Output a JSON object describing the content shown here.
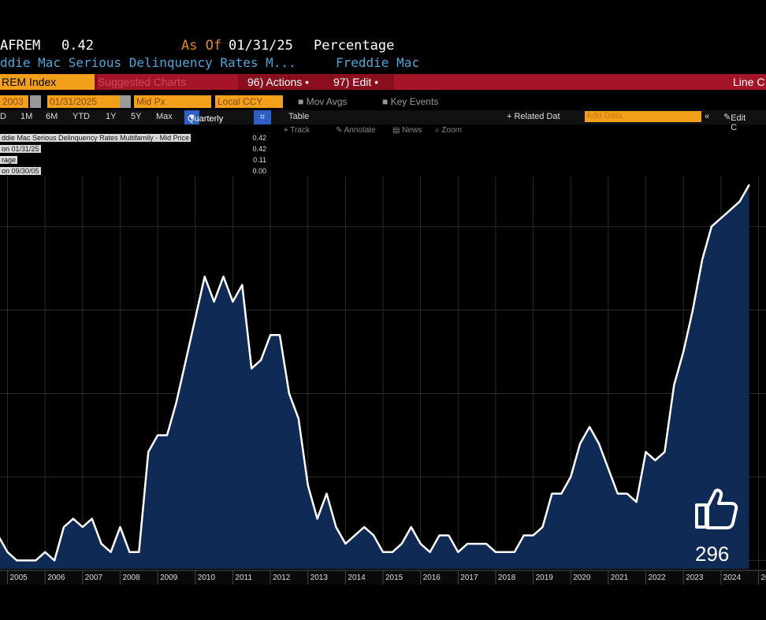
{
  "header": {
    "ticker": "AFREM",
    "last_value": "0.42",
    "as_of_label": "As Of",
    "as_of_date": "01/31/25",
    "unit": "Percentage",
    "description": "ddie Mac Serious Delinquency Rates M...",
    "source": "Freddie Mac"
  },
  "toolbar": {
    "index": "REM Index",
    "suggested": "Suggested Charts",
    "actions": "96) Actions •",
    "edit": "97) Edit •",
    "chart_type": "Line C"
  },
  "controls": {
    "start_date": "2003",
    "end_date": "01/31/2025",
    "price_field": "Mid Px",
    "currency": "Local CCY",
    "mov_avgs": "Mov Avgs",
    "key_events": "Key Events"
  },
  "periods": [
    "D",
    "1M",
    "6M",
    "YTD",
    "1Y",
    "5Y",
    "Max"
  ],
  "frequency": "Quarterly",
  "table_label": "Table",
  "related_data": "+ Related Dat",
  "add_data": "Add Data",
  "edit_chart": "Edit C",
  "tools": [
    "Track",
    "Annotate",
    "News",
    "Zoom"
  ],
  "legend": [
    {
      "label": "ddie Mac Serious Delinquency Rates Multifamily - Mid Price",
      "value": "0.42"
    },
    {
      "label": "on 01/31/25",
      "value": "0.42"
    },
    {
      "label": "rage",
      "value": "0.11"
    },
    {
      "label": "on 09/30/05",
      "value": "0.00"
    }
  ],
  "like_count": "296",
  "chart_data": {
    "type": "area",
    "title": "",
    "xlabel": "",
    "ylabel": "",
    "xlim": [
      2004.8,
      2025.2
    ],
    "ylim": [
      -0.01,
      0.46
    ],
    "x_ticks": [
      "2005",
      "2006",
      "2007",
      "2008",
      "2009",
      "2010",
      "2011",
      "2012",
      "2013",
      "2014",
      "2015",
      "2016",
      "2017",
      "2018",
      "2019",
      "2020",
      "2021",
      "2022",
      "2023",
      "2024",
      "20"
    ],
    "grid": true,
    "line_color": "#ffffff",
    "fill_color": "#0f2a55",
    "series": [
      {
        "points": [
          [
            2004.75,
            0.03
          ],
          [
            2005.0,
            0.01
          ],
          [
            2005.25,
            0.0
          ],
          [
            2005.5,
            0.0
          ],
          [
            2005.75,
            0.0
          ],
          [
            2006.0,
            0.01
          ],
          [
            2006.25,
            0.0
          ],
          [
            2006.5,
            0.04
          ],
          [
            2006.75,
            0.05
          ],
          [
            2007.0,
            0.04
          ],
          [
            2007.25,
            0.05
          ],
          [
            2007.5,
            0.02
          ],
          [
            2007.75,
            0.01
          ],
          [
            2008.0,
            0.04
          ],
          [
            2008.25,
            0.01
          ],
          [
            2008.5,
            0.01
          ],
          [
            2008.75,
            0.13
          ],
          [
            2009.0,
            0.15
          ],
          [
            2009.25,
            0.15
          ],
          [
            2009.5,
            0.19
          ],
          [
            2009.75,
            0.24
          ],
          [
            2010.0,
            0.29
          ],
          [
            2010.25,
            0.34
          ],
          [
            2010.5,
            0.31
          ],
          [
            2010.75,
            0.34
          ],
          [
            2011.0,
            0.31
          ],
          [
            2011.25,
            0.33
          ],
          [
            2011.5,
            0.23
          ],
          [
            2011.75,
            0.24
          ],
          [
            2012.0,
            0.27
          ],
          [
            2012.25,
            0.27
          ],
          [
            2012.5,
            0.2
          ],
          [
            2012.75,
            0.17
          ],
          [
            2013.0,
            0.09
          ],
          [
            2013.25,
            0.05
          ],
          [
            2013.5,
            0.08
          ],
          [
            2013.75,
            0.04
          ],
          [
            2014.0,
            0.02
          ],
          [
            2014.25,
            0.03
          ],
          [
            2014.5,
            0.04
          ],
          [
            2014.75,
            0.03
          ],
          [
            2015.0,
            0.01
          ],
          [
            2015.25,
            0.01
          ],
          [
            2015.5,
            0.02
          ],
          [
            2015.75,
            0.04
          ],
          [
            2016.0,
            0.02
          ],
          [
            2016.25,
            0.01
          ],
          [
            2016.5,
            0.03
          ],
          [
            2016.75,
            0.03
          ],
          [
            2017.0,
            0.01
          ],
          [
            2017.25,
            0.02
          ],
          [
            2017.5,
            0.02
          ],
          [
            2017.75,
            0.02
          ],
          [
            2018.0,
            0.01
          ],
          [
            2018.25,
            0.01
          ],
          [
            2018.5,
            0.01
          ],
          [
            2018.75,
            0.03
          ],
          [
            2019.0,
            0.03
          ],
          [
            2019.25,
            0.04
          ],
          [
            2019.5,
            0.08
          ],
          [
            2019.75,
            0.08
          ],
          [
            2020.0,
            0.1
          ],
          [
            2020.25,
            0.14
          ],
          [
            2020.5,
            0.16
          ],
          [
            2020.75,
            0.14
          ],
          [
            2021.0,
            0.11
          ],
          [
            2021.25,
            0.08
          ],
          [
            2021.5,
            0.08
          ],
          [
            2021.75,
            0.07
          ],
          [
            2022.0,
            0.13
          ],
          [
            2022.25,
            0.12
          ],
          [
            2022.5,
            0.13
          ],
          [
            2022.75,
            0.21
          ],
          [
            2023.0,
            0.25
          ],
          [
            2023.25,
            0.3
          ],
          [
            2023.5,
            0.36
          ],
          [
            2023.75,
            0.4
          ],
          [
            2024.0,
            0.41
          ],
          [
            2024.25,
            0.42
          ],
          [
            2024.5,
            0.43
          ],
          [
            2024.75,
            0.45
          ]
        ]
      }
    ]
  }
}
